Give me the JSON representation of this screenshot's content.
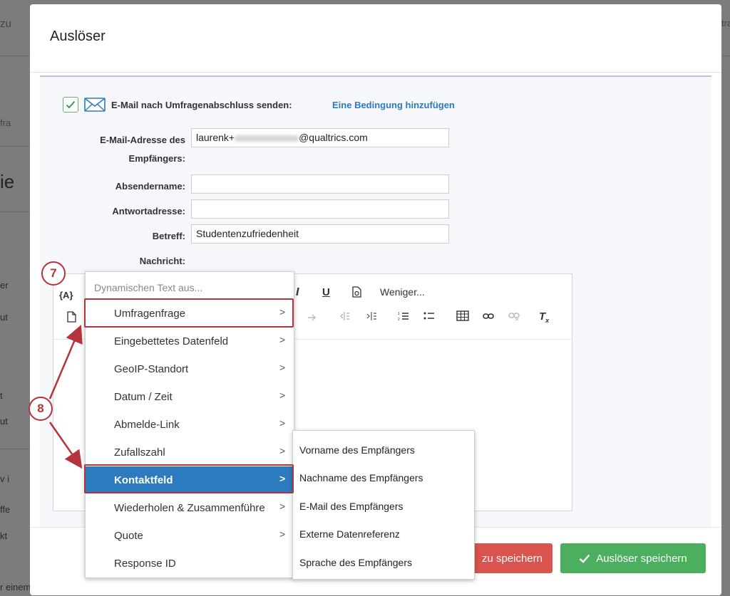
{
  "background": {
    "left_fragments": [
      "zu",
      "fra",
      "ie",
      "er",
      "ut",
      "t",
      "ut",
      "v i",
      "ffe",
      "kt",
      "r einem"
    ],
    "right_fragments": [
      "tra"
    ]
  },
  "modal": {
    "title": "Auslöser"
  },
  "trigger": {
    "label": "E-Mail nach Umfragenabschluss senden:",
    "condition_link": "Eine Bedingung hinzufügen",
    "checked": true
  },
  "form": {
    "recipient_label_line1": "E-Mail-Adresse des",
    "recipient_label_line2": "Empfängers:",
    "recipient_value_prefix": "laurenk+",
    "recipient_value_suffix": "@qualtrics.com",
    "sender_label": "Absendername:",
    "sender_value": "",
    "reply_label": "Antwortadresse:",
    "reply_value": "",
    "subject_label": "Betreff:",
    "subject_value": "Studentenzufriedenheit",
    "message_label": "Nachricht:"
  },
  "editor_toolbar": {
    "piped_text": "{A}",
    "italic": "I",
    "underline": "U",
    "less": "Weniger...",
    "clear_format": "Tx"
  },
  "dropdown": {
    "search_placeholder": "Dynamischen Text aus...",
    "items": [
      {
        "label": "Umfragenfrage",
        "has_submenu": true
      },
      {
        "label": "Eingebettetes Datenfeld",
        "has_submenu": true
      },
      {
        "label": "GeoIP-Standort",
        "has_submenu": true
      },
      {
        "label": "Datum / Zeit",
        "has_submenu": true
      },
      {
        "label": "Abmelde-Link",
        "has_submenu": true
      },
      {
        "label": "Zufallszahl",
        "has_submenu": true
      },
      {
        "label": "Kontaktfeld",
        "has_submenu": true,
        "active": true
      },
      {
        "label": "Wiederholen & Zusammenführe",
        "has_submenu": true
      },
      {
        "label": "Quote",
        "has_submenu": true
      },
      {
        "label": "Response ID",
        "has_submenu": false
      }
    ],
    "chevron": ">"
  },
  "submenu": {
    "items": [
      "Vorname des Empfängers",
      "Nachname des Empfängers",
      "E-Mail des Empfängers",
      "Externe Datenreferenz",
      "Sprache des Empfängers"
    ]
  },
  "callouts": {
    "step7": "7",
    "step8": "8"
  },
  "footer": {
    "partial_button": "zu speichern",
    "save_button": "Auslöser speichern"
  },
  "colors": {
    "accent_blue": "#2d7bbf",
    "save_green": "#4cae5f",
    "callout_red": "#b5333a"
  }
}
